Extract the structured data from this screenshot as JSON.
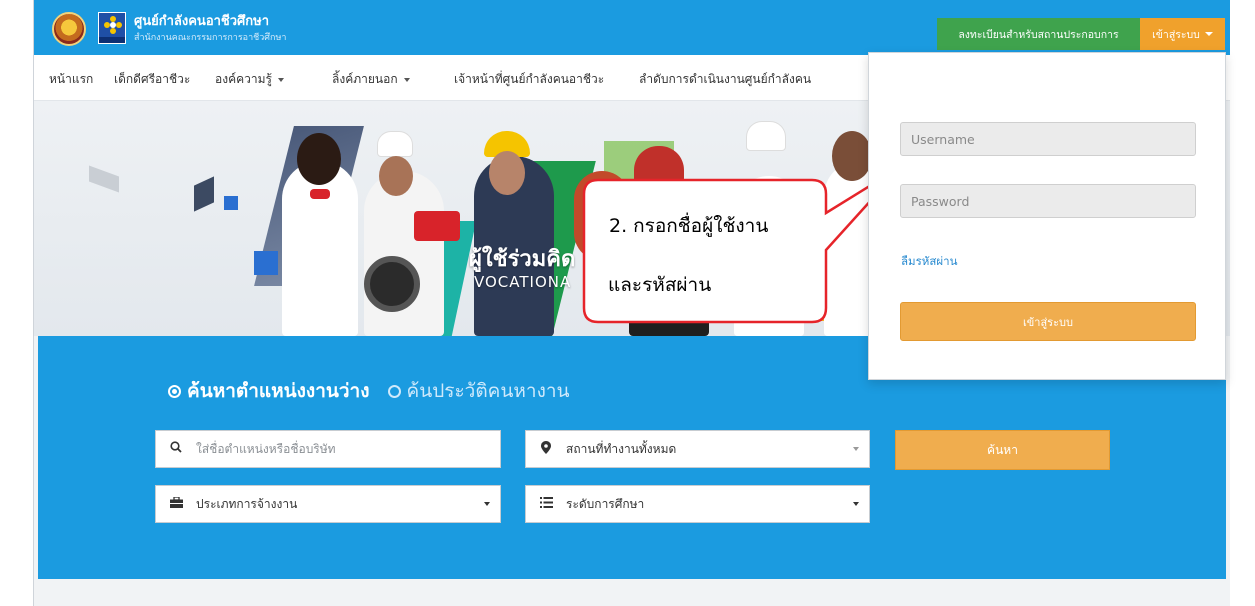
{
  "header": {
    "org_title": "ศูนย์กำลังคนอาชีวศึกษา",
    "org_subtitle": "สำนักงานคณะกรรมการการอาชีวศึกษา",
    "register_button": "ลงทะเบียนสำหรับสถานประกอบการ",
    "login_button": "เข้าสู่ระบบ"
  },
  "nav": {
    "items": [
      {
        "label": "หน้าแรก",
        "dropdown": false
      },
      {
        "label": "เด็กดีศรีอาชีวะ",
        "dropdown": false
      },
      {
        "label": "องค์ความรู้",
        "dropdown": true
      },
      {
        "label": "ลิ้งค์ภายนอก",
        "dropdown": true
      },
      {
        "label": "เจ้าหน้าที่ศูนย์กำลังคนอาชีวะ",
        "dropdown": false
      },
      {
        "label": "ลำดับการดำเนินงานศูนย์กำลังคน",
        "dropdown": false
      }
    ]
  },
  "hero": {
    "headline": "ผู้ใช้ร่วมคิด",
    "sub": "VOCATIONA"
  },
  "search": {
    "tab_active": "ค้นหาตำแหน่งงานว่าง",
    "tab_inactive": "ค้นประวัติคนหางาน",
    "keyword_placeholder": "ใส่ชื่อตำแหน่งหรือชื่อบริษัท",
    "location_value": "สถานที่ทำงานทั้งหมด",
    "employment_value": "ประเภทการจ้างงาน",
    "education_value": "ระดับการศึกษา",
    "search_button": "ค้นหา"
  },
  "login": {
    "username_placeholder": "Username",
    "password_placeholder": "Password",
    "forgot_link": "ลืมรหัสผ่าน",
    "submit_button": "เข้าสู่ระบบ"
  },
  "callout": {
    "line1": "2. กรอกชื่อผู้ใช้งาน",
    "line2": "และรหัสผ่าน"
  },
  "colors": {
    "primary_blue": "#1b9be0",
    "register_green": "#3fa34d",
    "accent_orange": "#f0ad4e"
  }
}
